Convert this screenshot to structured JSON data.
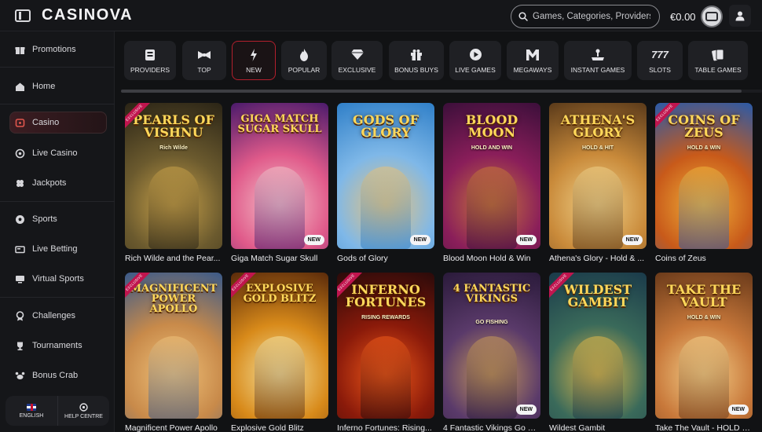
{
  "header": {
    "logo": "CASINOVA",
    "search_placeholder": "Games, Categories, Providers",
    "balance": "€0.00"
  },
  "sidebar": {
    "items": [
      {
        "label": "Promotions",
        "icon": "gift-icon"
      },
      {
        "label": "Home",
        "icon": "home-icon"
      },
      {
        "label": "Casino",
        "icon": "casino-icon",
        "active": true
      },
      {
        "label": "Live Casino",
        "icon": "live-casino-icon"
      },
      {
        "label": "Jackpots",
        "icon": "clover-icon"
      },
      {
        "label": "Sports",
        "icon": "soccer-ball-icon"
      },
      {
        "label": "Live Betting",
        "icon": "live-tv-icon"
      },
      {
        "label": "Virtual Sports",
        "icon": "virtual-sports-icon"
      },
      {
        "label": "Challenges",
        "icon": "medal-icon"
      },
      {
        "label": "Tournaments",
        "icon": "trophy-icon"
      },
      {
        "label": "Bonus Crab",
        "icon": "crab-icon"
      }
    ],
    "footer": {
      "language": "ENGLISH",
      "help": "HELP CENTRE"
    }
  },
  "categories": [
    {
      "label": "PROVIDERS",
      "icon": "providers-icon"
    },
    {
      "label": "TOP",
      "icon": "bow-icon"
    },
    {
      "label": "NEW",
      "icon": "lightning-icon",
      "active": true
    },
    {
      "label": "POPULAR",
      "icon": "flame-icon"
    },
    {
      "label": "EXCLUSIVE",
      "icon": "diamond-icon"
    },
    {
      "label": "BONUS BUYS",
      "icon": "gift-box-icon"
    },
    {
      "label": "LIVE GAMES",
      "icon": "play-icon"
    },
    {
      "label": "MEGAWAYS",
      "icon": "megaways-icon"
    },
    {
      "label": "INSTANT GAMES",
      "icon": "joystick-icon"
    },
    {
      "label": "SLOTS",
      "icon": "slots-777-icon"
    },
    {
      "label": "TABLE GAMES",
      "icon": "cards-icon"
    }
  ],
  "badges": {
    "exclusive": "EXCLUSIVE",
    "new": "NEW"
  },
  "games": [
    {
      "name": "Rich Wilde and the Pear...",
      "art_title": "PEARLS OF VISHNU",
      "art_subtitle": "Rich Wilde",
      "exclusive": true,
      "new": false,
      "palette": [
        "#2a2416",
        "#6b5a2e",
        "#c9a24a"
      ]
    },
    {
      "name": "Giga Match Sugar Skull",
      "art_title": "GIGA MATCH SUGAR SKULL",
      "art_subtitle": "",
      "exclusive": false,
      "new": true,
      "palette": [
        "#4a1a6b",
        "#e05a8a",
        "#f4c2c9"
      ]
    },
    {
      "name": "Gods of Glory",
      "art_title": "GODS OF GLORY",
      "art_subtitle": "",
      "exclusive": false,
      "new": true,
      "palette": [
        "#2f7fc8",
        "#7fb8e8",
        "#e8c27a"
      ]
    },
    {
      "name": "Blood Moon Hold & Win",
      "art_title": "BLOOD MOON",
      "art_subtitle": "HOLD AND WIN",
      "exclusive": false,
      "new": true,
      "palette": [
        "#3b0f3a",
        "#8a1e5a",
        "#c8783a"
      ]
    },
    {
      "name": "Athena's Glory - Hold & ...",
      "art_title": "ATHENA'S GLORY",
      "art_subtitle": "HOLD & HIT",
      "exclusive": false,
      "new": true,
      "palette": [
        "#5a3a1a",
        "#c98a3a",
        "#f0d28a"
      ]
    },
    {
      "name": "Coins of Zeus",
      "art_title": "COINS OF ZEUS",
      "art_subtitle": "HOLD & WIN",
      "exclusive": true,
      "new": false,
      "palette": [
        "#2a5aa8",
        "#c85a1a",
        "#f2b43a"
      ]
    },
    {
      "name": "Magnificent Power Apollo",
      "art_title": "MAGNIFICENT POWER APOLLO",
      "art_subtitle": "",
      "exclusive": true,
      "new": false,
      "palette": [
        "#3a5a8a",
        "#c88a4a",
        "#f0c27a"
      ]
    },
    {
      "name": "Explosive Gold Blitz",
      "art_title": "EXPLOSIVE GOLD BLITZ",
      "art_subtitle": "",
      "exclusive": true,
      "new": false,
      "palette": [
        "#5a2a0a",
        "#d88a1a",
        "#f4e2a0"
      ]
    },
    {
      "name": "Inferno Fortunes: Rising...",
      "art_title": "INFERNO FORTUNES",
      "art_subtitle": "RISING REWARDS",
      "exclusive": true,
      "new": false,
      "palette": [
        "#2a0a0a",
        "#8a1a0a",
        "#f05a1a"
      ]
    },
    {
      "name": "4 Fantastic Vikings Go Fi...",
      "art_title": "4 FANTASTIC VIKINGS",
      "art_subtitle": "GO FISHING",
      "exclusive": false,
      "new": true,
      "palette": [
        "#2a1a3a",
        "#5a3a6a",
        "#c89a5a"
      ]
    },
    {
      "name": "Wildest Gambit",
      "art_title": "WILDEST GAMBIT",
      "art_subtitle": "",
      "exclusive": true,
      "new": false,
      "palette": [
        "#1a3a4a",
        "#3a6a5a",
        "#e0b84a"
      ]
    },
    {
      "name": "Take The Vault - HOLD & ...",
      "art_title": "TAKE THE VAULT",
      "art_subtitle": "HOLD & WIN",
      "exclusive": false,
      "new": true,
      "palette": [
        "#6a3a1a",
        "#c8783a",
        "#f4d08a"
      ]
    }
  ]
}
